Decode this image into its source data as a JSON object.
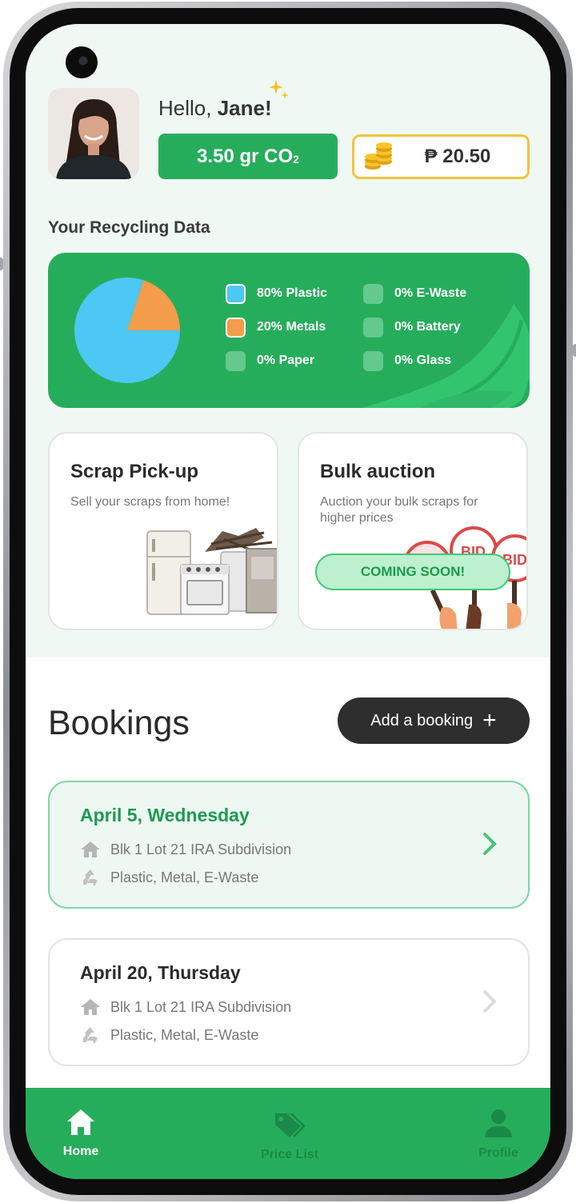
{
  "header": {
    "greeting": "Hello,",
    "user_name": "Jane!",
    "co2_value": "3.50 gr CO",
    "co2_subscript": "2",
    "wallet_amount": "₱ 20.50"
  },
  "recycling": {
    "title": "Your Recycling Data",
    "chart_data": {
      "type": "pie",
      "slices": [
        {
          "label": "Plastic",
          "value": 80,
          "color": "#4dc8f4"
        },
        {
          "label": "Metals",
          "value": 20,
          "color": "#f39c4a"
        },
        {
          "label": "E-Waste",
          "value": 0
        },
        {
          "label": "Battery",
          "value": 0
        },
        {
          "label": "Paper",
          "value": 0
        },
        {
          "label": "Glass",
          "value": 0
        }
      ]
    },
    "legend": [
      {
        "label": "80% Plastic",
        "color": "#4dc8f4"
      },
      {
        "label": "0% E-Waste",
        "color": "#64c98d"
      },
      {
        "label": "20% Metals",
        "color": "#f39c4a"
      },
      {
        "label": "0% Battery",
        "color": "#64c98d"
      },
      {
        "label": "0% Paper",
        "color": "#64c98d"
      },
      {
        "label": "0% Glass",
        "color": "#64c98d"
      }
    ]
  },
  "features": {
    "scrap": {
      "title": "Scrap Pick-up",
      "description": "Sell your scraps from home!"
    },
    "auction": {
      "title": "Bulk auction",
      "description": "Auction your bulk scraps for higher prices",
      "badge": "COMING SOON!",
      "bid_sign": "BID"
    }
  },
  "bookings": {
    "title": "Bookings",
    "add_label": "Add a booking",
    "items": [
      {
        "date": "April 5, Wednesday",
        "address": "Blk 1 Lot 21 IRA Subdivision",
        "materials": "Plastic, Metal, E-Waste"
      },
      {
        "date": "April 20, Thursday",
        "address": "Blk 1 Lot 21 IRA Subdivision",
        "materials": "Plastic, Metal, E-Waste"
      }
    ]
  },
  "nav": {
    "home": "Home",
    "price_list": "Price List",
    "profile": "Profile"
  },
  "colors": {
    "brand_green": "#26ad5c",
    "accent_gold": "#f0c43e"
  }
}
